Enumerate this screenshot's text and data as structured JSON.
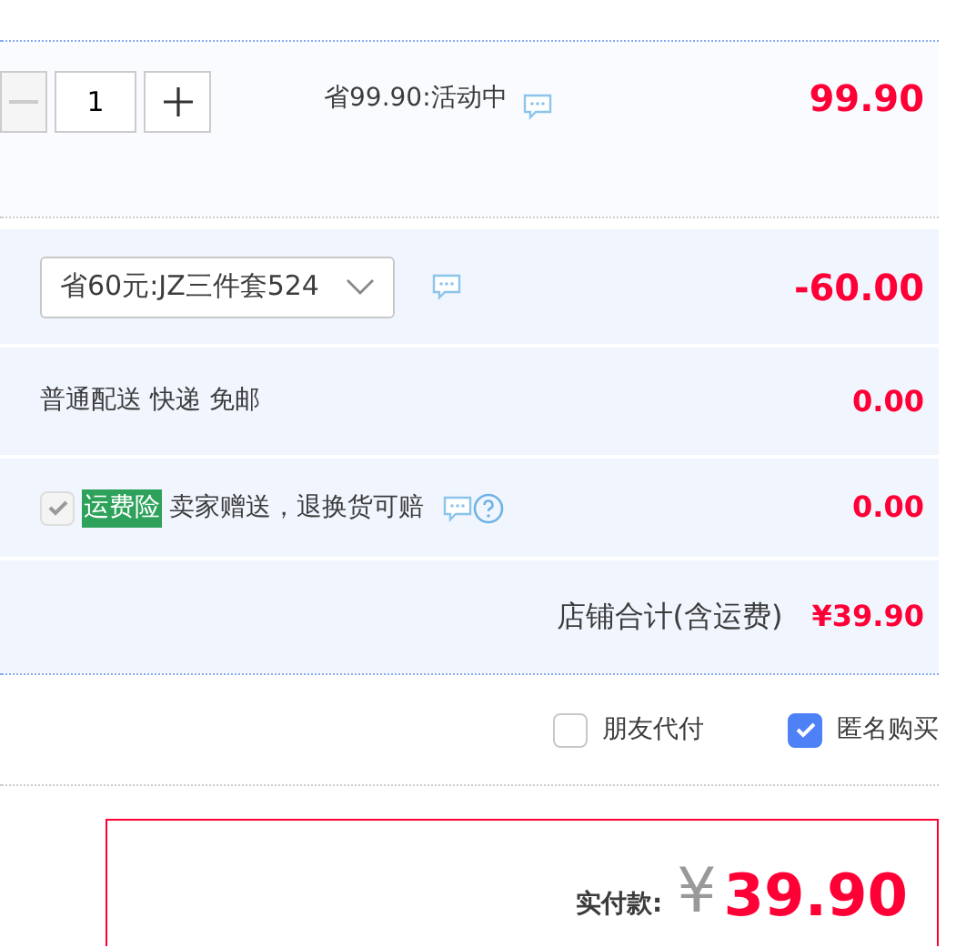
{
  "item": {
    "quantity": "1",
    "decrease_disabled": true,
    "promo": "省99.90:活动中",
    "price": "99.90"
  },
  "summary_rows": [
    {
      "kind": "select",
      "value": "省60元:JZ三件套524",
      "amount": "-60.00"
    },
    {
      "kind": "text",
      "label": "普通配送 快递 免邮",
      "amount": "0.00"
    },
    {
      "kind": "insurance",
      "checked": true,
      "disabled": true,
      "tag": "运费险",
      "label": "卖家赠送，退换货可赔",
      "amount": "0.00"
    }
  ],
  "store_total": {
    "label": "店铺合计(含运费)",
    "amount": "¥39.90"
  },
  "options": [
    {
      "label": "朋友代付",
      "checked": false
    },
    {
      "label": "匿名购买",
      "checked": true
    }
  ],
  "payment": {
    "label": "实付款:",
    "currency": "¥",
    "amount": "39.90"
  }
}
